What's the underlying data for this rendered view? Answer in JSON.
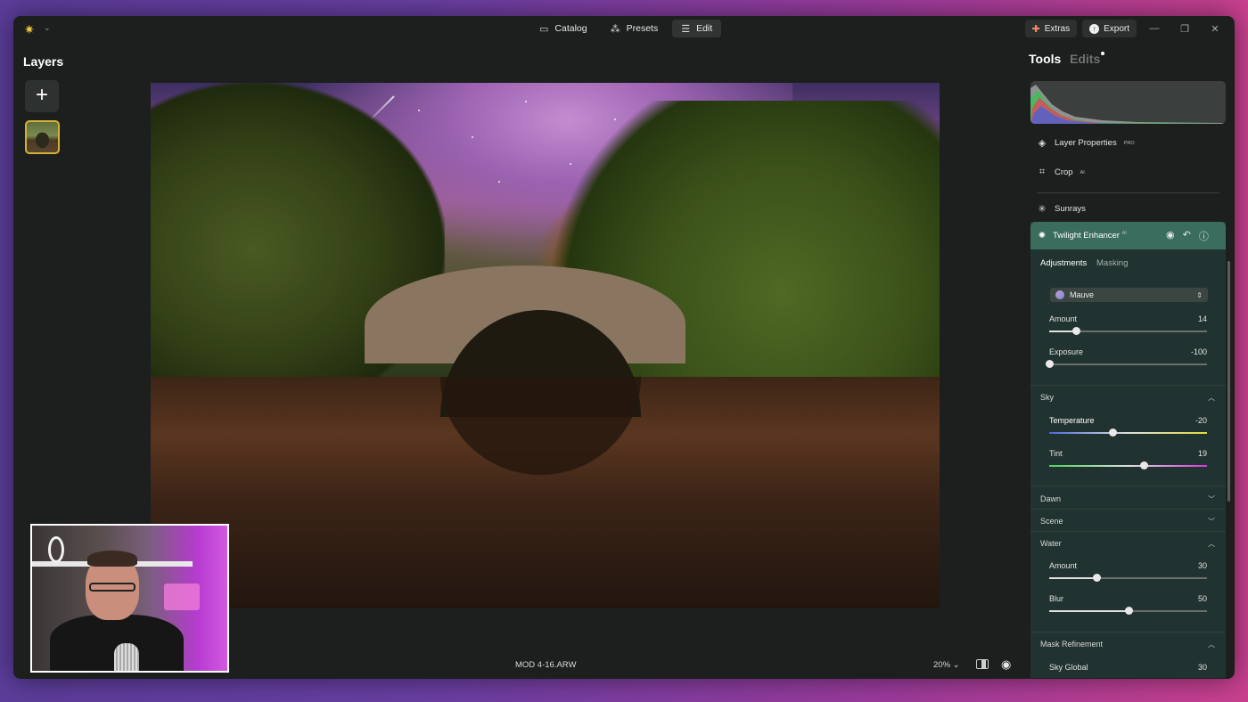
{
  "titlebar": {
    "nav_tabs": [
      {
        "label": "Catalog",
        "icon": "folder-icon",
        "active": false
      },
      {
        "label": "Presets",
        "icon": "sparkle-icon",
        "active": false
      },
      {
        "label": "Edit",
        "icon": "sliders-icon",
        "active": true
      }
    ],
    "extras_label": "Extras",
    "export_label": "Export"
  },
  "layers": {
    "title": "Layers",
    "add_label": "+"
  },
  "canvas": {
    "filename": "MOD 4-16.ARW",
    "zoom": "20%"
  },
  "panel": {
    "tools_tab": "Tools",
    "edits_tab": "Edits",
    "tools": [
      {
        "label": "Layer Properties",
        "badge": "PRO",
        "icon": "layers-icon"
      },
      {
        "label": "Crop",
        "badge": "AI",
        "icon": "crop-icon"
      },
      {
        "label": "Sunrays",
        "badge": "",
        "icon": "sun-icon"
      }
    ],
    "twilight": {
      "title": "Twilight Enhancer",
      "badge": "AI",
      "subtabs": [
        "Adjustments",
        "Masking"
      ],
      "preset": "Mauve",
      "sliders_main": [
        {
          "label": "Amount",
          "value": "14",
          "level": 0.17
        },
        {
          "label": "Exposure",
          "value": "-100",
          "level": 0.0
        }
      ],
      "sky_title": "Sky",
      "sliders_sky": [
        {
          "label": "Temperature",
          "value": "-20",
          "level": 0.4
        },
        {
          "label": "Tint",
          "value": "19",
          "level": 0.6
        }
      ],
      "dawn_title": "Dawn",
      "scene_title": "Scene",
      "water_title": "Water",
      "sliders_water": [
        {
          "label": "Amount",
          "value": "30",
          "level": 0.3
        },
        {
          "label": "Blur",
          "value": "50",
          "level": 0.5
        }
      ],
      "mask_title": "Mask Refinement",
      "sliders_mask": [
        {
          "label": "Sky Global",
          "value": "30",
          "level": 0.3
        }
      ]
    }
  },
  "colors": {
    "accent": "#3a6d5e",
    "panel": "#213330",
    "layer_border": "#d6b036"
  }
}
